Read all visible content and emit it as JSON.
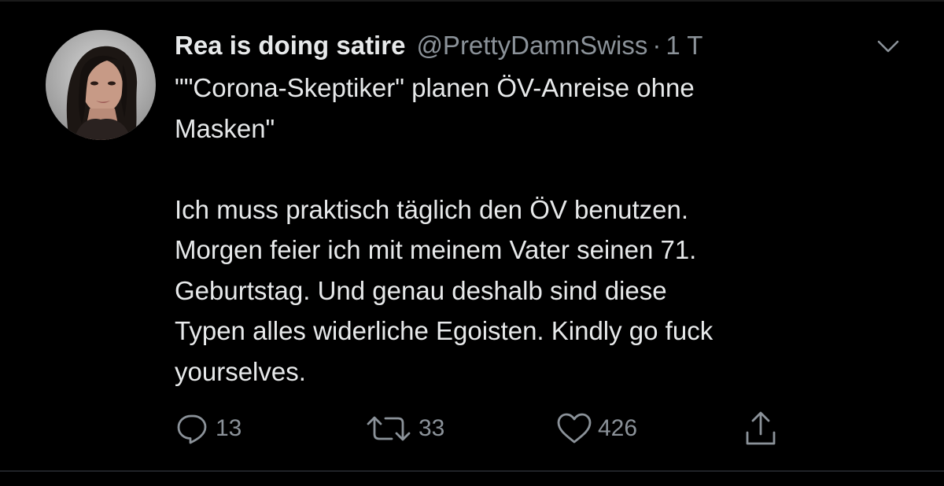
{
  "tweet": {
    "display_name": "Rea is doing satire",
    "handle": "@PrettyDamnSwiss",
    "separator": "·",
    "time": "1 T",
    "text": "\"\"Corona-Skeptiker\" planen ÖV-Anreise ohne\nMasken\"\n\nIch muss praktisch täglich den ÖV benutzen.\nMorgen feier ich mit meinem Vater seinen 71.\nGeburtstag. Und genau deshalb sind diese\nTypen alles widerliche Egoisten. Kindly go fuck\nyourselves."
  },
  "actions": {
    "reply_count": "13",
    "retweet_count": "33",
    "like_count": "426"
  },
  "icons": {
    "reply": "speech-bubble-icon",
    "retweet": "retweet-arrows-icon",
    "like": "heart-icon",
    "share": "share-upload-icon",
    "menu": "chevron-down-icon"
  },
  "colors": {
    "background": "#000000",
    "primary_text": "#e7e9ea",
    "secondary_text": "#8b9299"
  }
}
